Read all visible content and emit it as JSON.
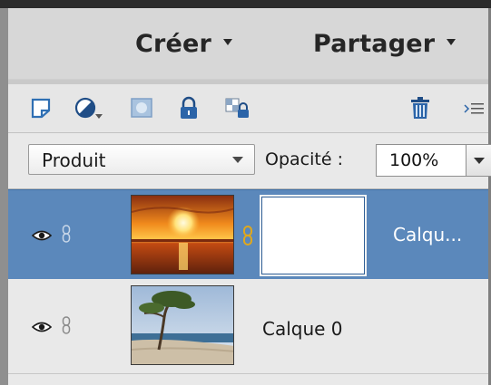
{
  "menu": {
    "create_label": "Créer",
    "share_label": "Partager"
  },
  "blend_mode": {
    "selected": "Produit"
  },
  "opacity": {
    "label": "Opacité :",
    "value": "100%"
  },
  "layers": [
    {
      "name": "Calqu...",
      "selected": true,
      "visible": true,
      "has_mask": true,
      "thumbnail": "sunset over sea"
    },
    {
      "name": "Calque 0",
      "selected": false,
      "visible": true,
      "has_mask": false,
      "thumbnail": "tree on beach"
    }
  ],
  "icons": [
    "new-layer-icon",
    "adjustment-layer-icon",
    "layer-mask-icon",
    "lock-all-icon",
    "lock-transparency-icon",
    "trash-icon",
    "panel-menu-icon"
  ],
  "colors": {
    "selected_layer": "#5b88bb",
    "header": "#d7d7d7",
    "panel": "#e9e9e9"
  }
}
